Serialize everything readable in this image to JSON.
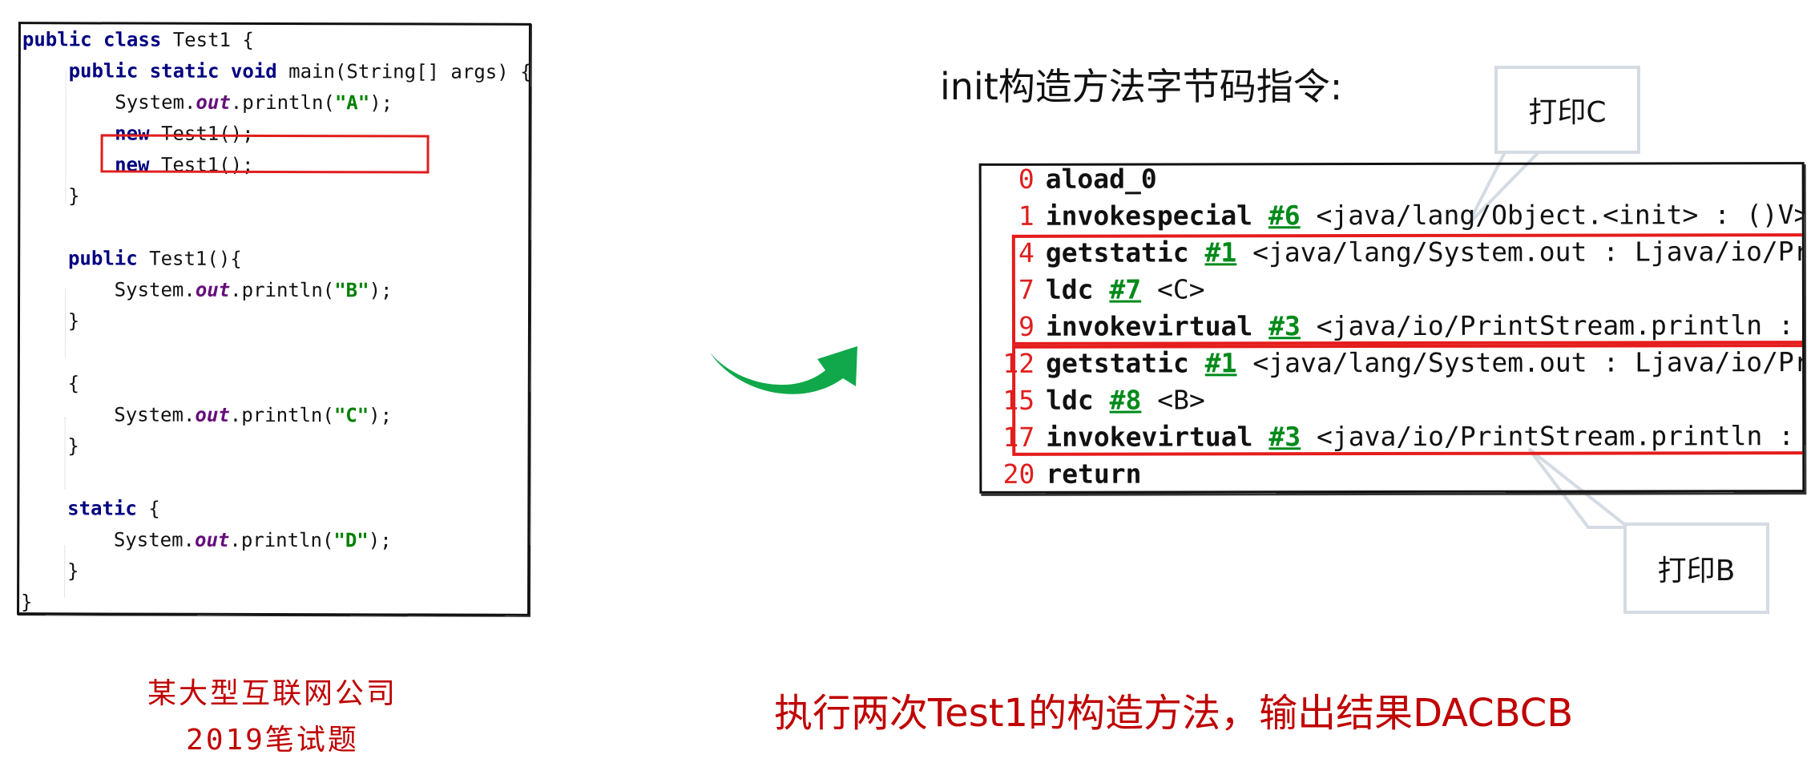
{
  "code": {
    "lines": [
      {
        "parts": [
          {
            "t": "public class ",
            "c": "kw"
          },
          {
            "t": "Test1 {",
            "c": ""
          }
        ]
      },
      {
        "parts": [
          {
            "t": "    public static void ",
            "c": "kw"
          },
          {
            "t": "main(String[] args) {",
            "c": ""
          }
        ]
      },
      {
        "parts": [
          {
            "t": "        System.",
            "c": ""
          },
          {
            "t": "out",
            "c": "fld"
          },
          {
            "t": ".println(",
            "c": ""
          },
          {
            "t": "\"A\"",
            "c": "str"
          },
          {
            "t": ");",
            "c": ""
          }
        ]
      },
      {
        "parts": [
          {
            "t": "        new ",
            "c": "kw"
          },
          {
            "t": "Test1();",
            "c": ""
          }
        ]
      },
      {
        "parts": [
          {
            "t": "        new ",
            "c": "kw"
          },
          {
            "t": "Test1();",
            "c": ""
          }
        ]
      },
      {
        "parts": [
          {
            "t": "    }",
            "c": ""
          }
        ]
      },
      {
        "parts": [
          {
            "t": "",
            "c": ""
          }
        ]
      },
      {
        "parts": [
          {
            "t": "    public ",
            "c": "kw"
          },
          {
            "t": "Test1(){",
            "c": ""
          }
        ]
      },
      {
        "parts": [
          {
            "t": "        System.",
            "c": ""
          },
          {
            "t": "out",
            "c": "fld"
          },
          {
            "t": ".println(",
            "c": ""
          },
          {
            "t": "\"B\"",
            "c": "str"
          },
          {
            "t": ");",
            "c": ""
          }
        ]
      },
      {
        "parts": [
          {
            "t": "    }",
            "c": ""
          }
        ]
      },
      {
        "parts": [
          {
            "t": "",
            "c": ""
          }
        ]
      },
      {
        "parts": [
          {
            "t": "    {",
            "c": ""
          }
        ]
      },
      {
        "parts": [
          {
            "t": "        System.",
            "c": ""
          },
          {
            "t": "out",
            "c": "fld"
          },
          {
            "t": ".println(",
            "c": ""
          },
          {
            "t": "\"C\"",
            "c": "str"
          },
          {
            "t": ");",
            "c": ""
          }
        ]
      },
      {
        "parts": [
          {
            "t": "    }",
            "c": ""
          }
        ]
      },
      {
        "parts": [
          {
            "t": "",
            "c": ""
          }
        ]
      },
      {
        "parts": [
          {
            "t": "    static ",
            "c": "kw"
          },
          {
            "t": "{",
            "c": ""
          }
        ]
      },
      {
        "parts": [
          {
            "t": "        System.",
            "c": ""
          },
          {
            "t": "out",
            "c": "fld"
          },
          {
            "t": ".println(",
            "c": ""
          },
          {
            "t": "\"D\"",
            "c": "str"
          },
          {
            "t": ");",
            "c": ""
          }
        ]
      },
      {
        "parts": [
          {
            "t": "    }",
            "c": ""
          }
        ]
      },
      {
        "parts": [
          {
            "t": "}",
            "c": ""
          }
        ]
      }
    ]
  },
  "caption_left": {
    "line1": "某大型互联网公司",
    "line2": "2019笔试题"
  },
  "heading": "init构造方法字节码指令:",
  "bytecode": {
    "rows": [
      {
        "num": "0",
        "op": "aload_0",
        "ref": "",
        "rest": ""
      },
      {
        "num": "1",
        "op": "invokespecial",
        "ref": "#6",
        "rest": "<java/lang/Object.<init> : ()V>"
      },
      {
        "num": "4",
        "op": "getstatic",
        "ref": "#1",
        "rest": "<java/lang/System.out : Ljava/io/PrintStream;>"
      },
      {
        "num": "7",
        "op": "ldc",
        "ref": "#7",
        "rest": "<C>"
      },
      {
        "num": "9",
        "op": "invokevirtual",
        "ref": "#3",
        "rest": "<java/io/PrintStream.println : (Ljava/lang/String;)V>"
      },
      {
        "num": "12",
        "op": "getstatic",
        "ref": "#1",
        "rest": "<java/lang/System.out : Ljava/io/PrintStream;>"
      },
      {
        "num": "15",
        "op": "ldc",
        "ref": "#8",
        "rest": "<B>"
      },
      {
        "num": "17",
        "op": "invokevirtual",
        "ref": "#3",
        "rest": "<java/io/PrintStream.println : (Ljava/lang/String;)V>"
      },
      {
        "num": "20",
        "op": "return",
        "ref": "",
        "rest": ""
      }
    ]
  },
  "callouts": {
    "top": "打印C",
    "bottom": "打印B"
  },
  "caption_right": "执行两次Test1的构造方法，输出结果DACBCB",
  "colors": {
    "highlight": "#e01e1e",
    "arrow": "#10a84a",
    "caption": "#c00000",
    "callout_border": "#d4dbe3"
  }
}
